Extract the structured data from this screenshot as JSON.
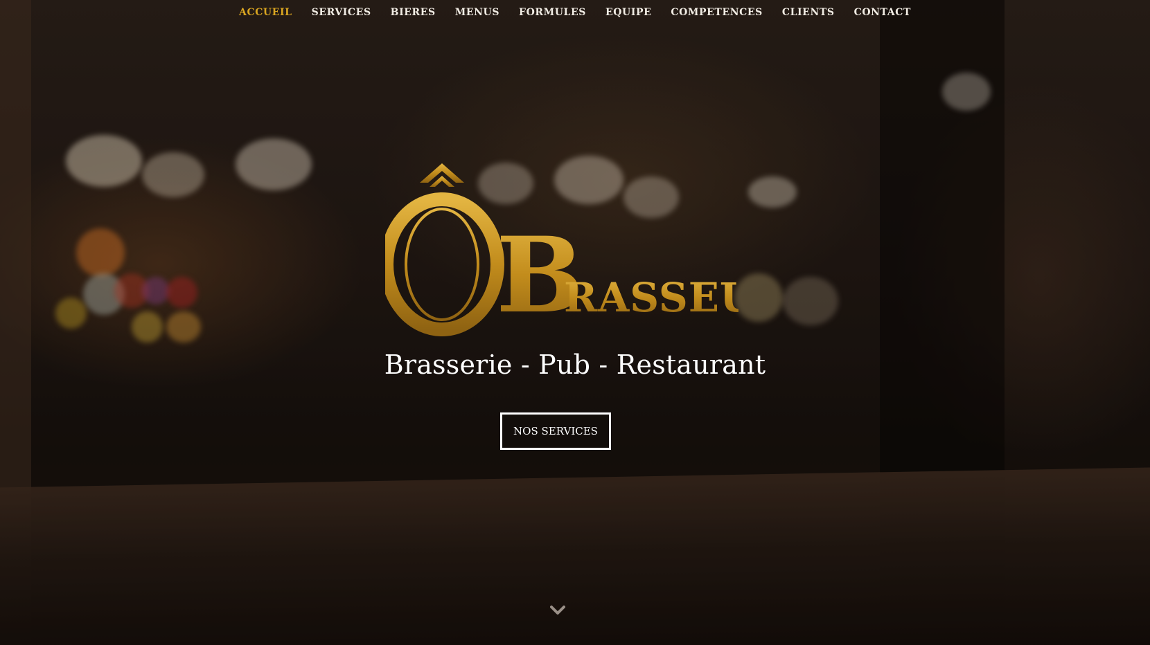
{
  "nav": {
    "items": [
      {
        "label": "ACCUEIL",
        "active": true
      },
      {
        "label": "SERVICES",
        "active": false
      },
      {
        "label": "BIERES",
        "active": false
      },
      {
        "label": "MENUS",
        "active": false
      },
      {
        "label": "FORMULES",
        "active": false
      },
      {
        "label": "EQUIPE",
        "active": false
      },
      {
        "label": "COMPETENCES",
        "active": false
      },
      {
        "label": "CLIENTS",
        "active": false
      },
      {
        "label": "CONTACT",
        "active": false
      }
    ]
  },
  "hero": {
    "logo_text": "ÔBRASSEUR",
    "tagline": "Brasserie - Pub - Restaurant",
    "cta_label": "NOS SERVICES",
    "scroll_icon": "chevron-down-icon"
  },
  "colors": {
    "accent": "#d9a521",
    "logo_gold": "#c8951f",
    "text_light": "#ffffff"
  }
}
